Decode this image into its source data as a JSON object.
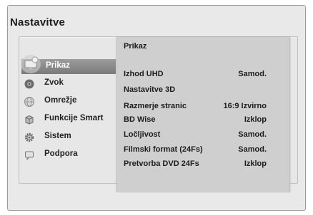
{
  "screen": {
    "title": "Nastavitve"
  },
  "menu": {
    "items": [
      {
        "label": "Prikaz",
        "icon": "display-icon",
        "selected": true
      },
      {
        "label": "Zvok",
        "icon": "sound-icon",
        "selected": false
      },
      {
        "label": "Omrežje",
        "icon": "network-icon",
        "selected": false
      },
      {
        "label": "Funkcije Smart",
        "icon": "smart-icon",
        "selected": false
      },
      {
        "label": "Sistem",
        "icon": "gear-icon",
        "selected": false
      },
      {
        "label": "Podpora",
        "icon": "support-icon",
        "selected": false
      }
    ]
  },
  "submenu": {
    "title": "Prikaz",
    "settings": [
      {
        "label": "Izhod UHD",
        "value": "Samod."
      },
      {
        "label": "Nastavitve 3D",
        "value": ""
      },
      {
        "label": "Razmerje stranic",
        "value": "16:9 Izvirno"
      },
      {
        "label": "BD Wise",
        "value": "Izklop"
      },
      {
        "label": "Ločljivost",
        "value": "Samod."
      },
      {
        "label": "Filmski format (24Fs)",
        "value": "Samod."
      },
      {
        "label": "Pretvorba DVD 24Fs",
        "value": "Izklop"
      }
    ]
  },
  "colors": {
    "highlight": "#8a8a8a",
    "submenu_bg": "#cfcfcf",
    "panel_bg": "#e7e7e7"
  }
}
